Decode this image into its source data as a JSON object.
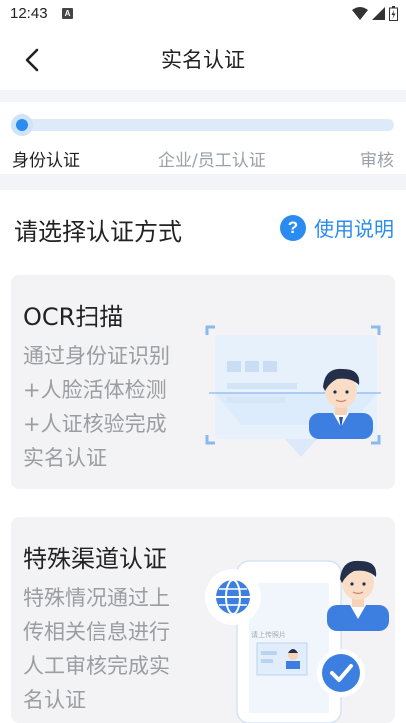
{
  "status_bar": {
    "time": "12:43",
    "notification_letter": "A"
  },
  "nav": {
    "title": "实名认证"
  },
  "progress": {
    "current_step": 1,
    "steps": [
      "身份认证",
      "企业/员工认证",
      "审核"
    ]
  },
  "section": {
    "title": "请选择认证方式",
    "help_icon_glyph": "?",
    "help_label": "使用说明"
  },
  "cards": [
    {
      "title": "OCR扫描",
      "desc_lines": [
        "通过身份证识别",
        "+人脸活体检测",
        "+人证核验完成",
        "实名认证"
      ]
    },
    {
      "title": "特殊渠道认证",
      "desc_lines": [
        "特殊情况通过上",
        "传相关信息进行",
        "人工审核完成实",
        "名认证"
      ],
      "illustration_text": "请上传照片"
    }
  ],
  "colors": {
    "accent": "#2a8cf0",
    "band": "#f2f4f8",
    "card_bg": "#f3f3f5",
    "muted_text": "#9a9da2"
  }
}
